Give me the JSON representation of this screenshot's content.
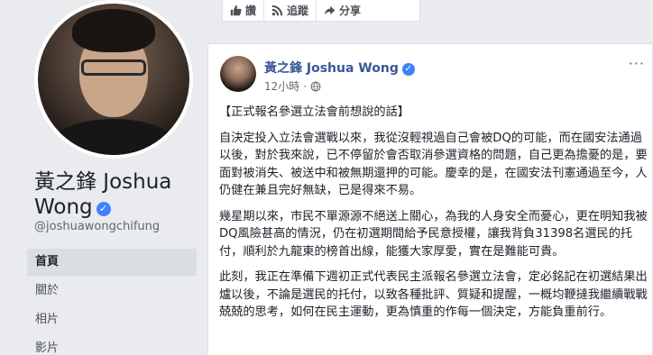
{
  "profile": {
    "name": "黃之鋒 Joshua Wong",
    "handle": "@joshuawongchifung",
    "nav": [
      "首頁",
      "關於",
      "相片",
      "影片"
    ]
  },
  "actions": {
    "like": "讚",
    "follow": "追蹤",
    "share": "分享"
  },
  "post": {
    "author": "黃之鋒 Joshua Wong",
    "time": "12小時",
    "dot": "·",
    "menu": "···",
    "paragraphs": [
      "【正式報名參選立法會前想說的話】",
      "自決定投入立法會選戰以來，我從沒輕視過自己會被DQ的可能，而在國安法通過以後，對於我來說，已不停留於會否取消參選資格的問題，自己更為擔憂的是，要面對被消失、被送中和被無期還押的可能。慶幸的是，在國安法刊憲通過至今，人仍健在兼且完好無缺，已是得來不易。",
      "幾星期以來，市民不單源源不絕送上關心，為我的人身安全而憂心，更在明知我被DQ風險甚高的情況，仍在初選期間給予民意授權，讓我背負31398名選民的托付，順利於九龍東的榜首出線，能獲大家厚愛，實在是難能可貴。",
      "此刻，我正在準備下週初正式代表民主派報名參選立法會，定必銘記在初選結果出爐以後，不論是選民的托付，以致各種批評、質疑和提醒，一概均鞭撻我繼續戰戰兢兢的思考，如何在民主運動，更為慎重的作每一個決定，方能負重前行。"
    ]
  },
  "colors": {
    "link": "#385898",
    "verified": "#4080ff",
    "background": "#e9ebee"
  }
}
